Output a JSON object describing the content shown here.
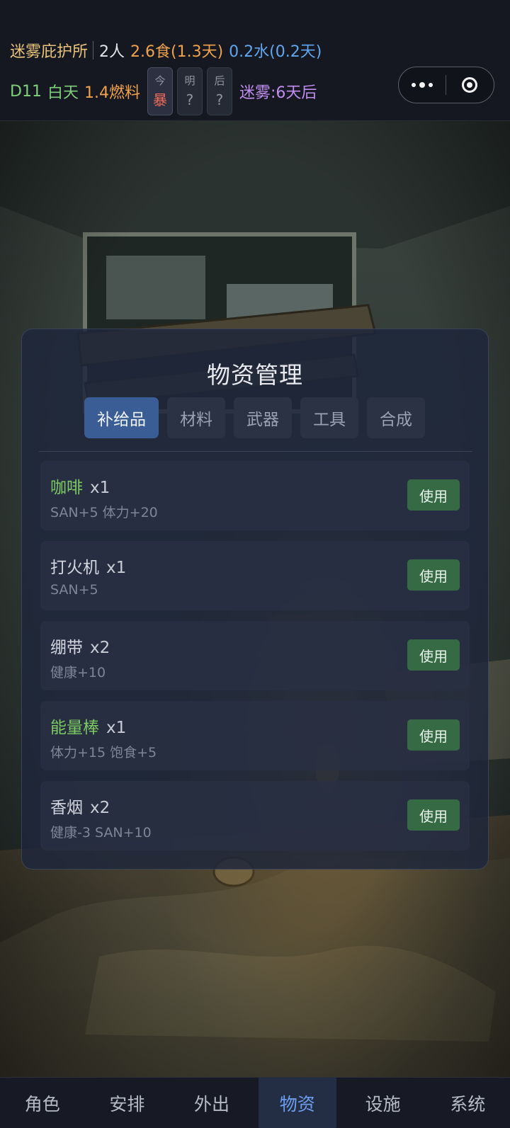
{
  "header": {
    "shelter_name": "迷雾庇护所",
    "population": "2人",
    "food": "2.6食(1.3天)",
    "water": "0.2水(0.2天)",
    "day": "D11",
    "time_of_day": "白天",
    "fuel": "1.4燃料",
    "fog_countdown": "迷雾:6天后",
    "weather": [
      {
        "label": "今",
        "value": "暴"
      },
      {
        "label": "明",
        "value": "?"
      },
      {
        "label": "后",
        "value": "?"
      }
    ]
  },
  "panel": {
    "title": "物资管理",
    "tabs": [
      "补给品",
      "材料",
      "武器",
      "工具",
      "合成"
    ],
    "active_tab": "补给品",
    "items": [
      {
        "name": "咖啡",
        "qty": "x1",
        "desc": "SAN+5 体力+20",
        "button": "使用",
        "highlight": true
      },
      {
        "name": "打火机",
        "qty": "x1",
        "desc": "SAN+5",
        "button": "使用",
        "highlight": false
      },
      {
        "name": "绷带",
        "qty": "x2",
        "desc": "健康+10",
        "button": "使用",
        "highlight": false
      },
      {
        "name": "能量棒",
        "qty": "x1",
        "desc": "体力+15 饱食+5",
        "button": "使用",
        "highlight": true
      },
      {
        "name": "香烟",
        "qty": "x2",
        "desc": "健康-3 SAN+10",
        "button": "使用",
        "highlight": false
      }
    ]
  },
  "bottom_nav": {
    "items": [
      "角色",
      "安排",
      "外出",
      "物资",
      "设施",
      "系统"
    ],
    "active": "物资"
  },
  "colors": {
    "accent_blue": "#3a5d96",
    "use_button": "#356a45",
    "highlight_green": "#7ccb62",
    "storm_red": "#f06a5a",
    "fog_purple": "#c08ef0"
  },
  "icons": [
    "more-icon",
    "close-mini-program-icon"
  ]
}
